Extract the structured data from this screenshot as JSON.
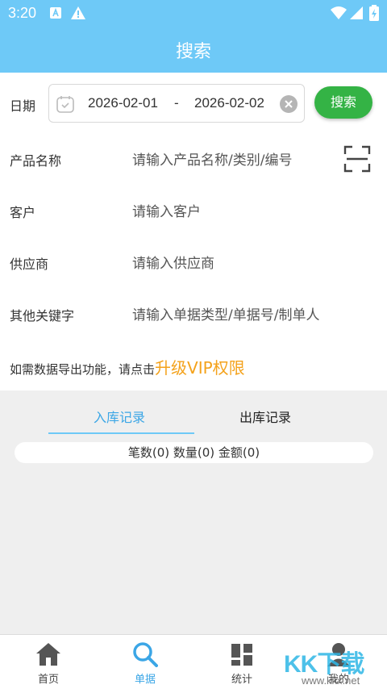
{
  "status_bar": {
    "time": "3:20"
  },
  "header": {
    "title": "搜索"
  },
  "form": {
    "date_label": "日期",
    "date_start": "2026-02-01",
    "date_separator": "-",
    "date_end": "2026-02-02",
    "search_button": "搜索",
    "product_label": "产品名称",
    "product_placeholder": "请输入产品名称/类别/编号",
    "customer_label": "客户",
    "customer_placeholder": "请输入客户",
    "supplier_label": "供应商",
    "supplier_placeholder": "请输入供应商",
    "keyword_label": "其他关键字",
    "keyword_placeholder": "请输入单据类型/单据号/制单人",
    "upgrade_prefix": "如需数据导出功能，请点击",
    "upgrade_link": "升级VIP权限"
  },
  "tabs": [
    {
      "label": "入库记录",
      "active": true
    },
    {
      "label": "出库记录",
      "active": false
    }
  ],
  "summary": "笔数(0) 数量(0) 金额(0)",
  "bottom_nav": [
    {
      "label": "首页",
      "icon": "home-icon"
    },
    {
      "label": "单据",
      "icon": "search-icon"
    },
    {
      "label": "统计",
      "icon": "grid-icon"
    },
    {
      "label": "我的",
      "icon": "user-icon"
    }
  ],
  "watermark": {
    "text": "KK下载",
    "url": "www.kkx.net"
  },
  "colors": {
    "primary": "#6ec9f7",
    "search_button": "#34b345",
    "upgrade_link": "#f4a21b",
    "active_tab": "#3ba6e6"
  }
}
